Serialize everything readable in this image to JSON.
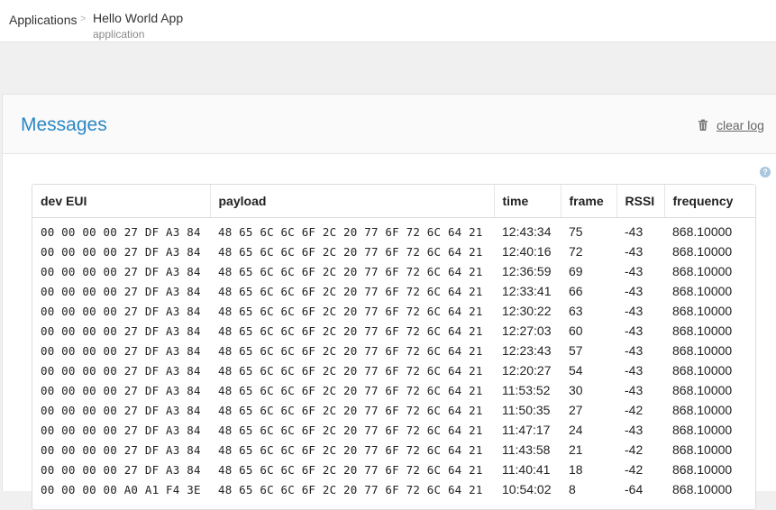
{
  "breadcrumb": {
    "root": "Applications",
    "separator": ">",
    "current_title": "Hello World App",
    "current_subtitle": "application"
  },
  "messages_panel": {
    "title": "Messages",
    "clear_log_label": "clear log",
    "clear_log_icon": "trash-icon",
    "help_icon_text": "?"
  },
  "colors": {
    "accent": "#2b87c5",
    "page_background": "#f0f0f0"
  },
  "table": {
    "columns": [
      "dev EUI",
      "payload",
      "time",
      "frame",
      "RSSI",
      "frequency"
    ],
    "rows": [
      [
        "00 00 00 00 27 DF A3 84",
        "48 65 6C 6C 6F 2C 20 77 6F 72 6C 64 21",
        "12:43:34",
        "75",
        "-43",
        "868.10000"
      ],
      [
        "00 00 00 00 27 DF A3 84",
        "48 65 6C 6C 6F 2C 20 77 6F 72 6C 64 21",
        "12:40:16",
        "72",
        "-43",
        "868.10000"
      ],
      [
        "00 00 00 00 27 DF A3 84",
        "48 65 6C 6C 6F 2C 20 77 6F 72 6C 64 21",
        "12:36:59",
        "69",
        "-43",
        "868.10000"
      ],
      [
        "00 00 00 00 27 DF A3 84",
        "48 65 6C 6C 6F 2C 20 77 6F 72 6C 64 21",
        "12:33:41",
        "66",
        "-43",
        "868.10000"
      ],
      [
        "00 00 00 00 27 DF A3 84",
        "48 65 6C 6C 6F 2C 20 77 6F 72 6C 64 21",
        "12:30:22",
        "63",
        "-43",
        "868.10000"
      ],
      [
        "00 00 00 00 27 DF A3 84",
        "48 65 6C 6C 6F 2C 20 77 6F 72 6C 64 21",
        "12:27:03",
        "60",
        "-43",
        "868.10000"
      ],
      [
        "00 00 00 00 27 DF A3 84",
        "48 65 6C 6C 6F 2C 20 77 6F 72 6C 64 21",
        "12:23:43",
        "57",
        "-43",
        "868.10000"
      ],
      [
        "00 00 00 00 27 DF A3 84",
        "48 65 6C 6C 6F 2C 20 77 6F 72 6C 64 21",
        "12:20:27",
        "54",
        "-43",
        "868.10000"
      ],
      [
        "00 00 00 00 27 DF A3 84",
        "48 65 6C 6C 6F 2C 20 77 6F 72 6C 64 21",
        "11:53:52",
        "30",
        "-43",
        "868.10000"
      ],
      [
        "00 00 00 00 27 DF A3 84",
        "48 65 6C 6C 6F 2C 20 77 6F 72 6C 64 21",
        "11:50:35",
        "27",
        "-42",
        "868.10000"
      ],
      [
        "00 00 00 00 27 DF A3 84",
        "48 65 6C 6C 6F 2C 20 77 6F 72 6C 64 21",
        "11:47:17",
        "24",
        "-43",
        "868.10000"
      ],
      [
        "00 00 00 00 27 DF A3 84",
        "48 65 6C 6C 6F 2C 20 77 6F 72 6C 64 21",
        "11:43:58",
        "21",
        "-42",
        "868.10000"
      ],
      [
        "00 00 00 00 27 DF A3 84",
        "48 65 6C 6C 6F 2C 20 77 6F 72 6C 64 21",
        "11:40:41",
        "18",
        "-42",
        "868.10000"
      ],
      [
        "00 00 00 00 A0 A1 F4 3E",
        "48 65 6C 6C 6F 2C 20 77 6F 72 6C 64 21",
        "10:54:02",
        "8",
        "-64",
        "868.10000"
      ]
    ]
  }
}
